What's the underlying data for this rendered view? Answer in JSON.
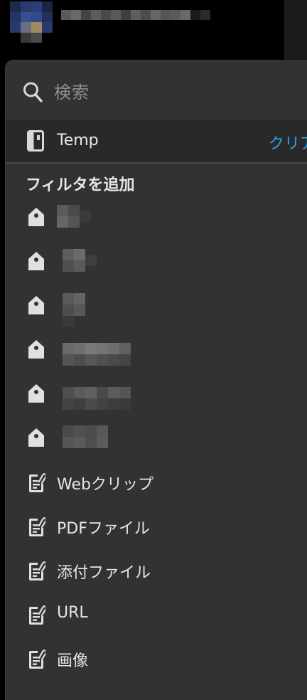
{
  "search": {
    "placeholder": "検索"
  },
  "selected_notebook": {
    "label": "Temp",
    "clear_label": "クリア"
  },
  "filters": {
    "title": "フィルタを追加",
    "tags": [
      {
        "label": ""
      },
      {
        "label": ""
      },
      {
        "label": ""
      },
      {
        "label": ""
      },
      {
        "label": ""
      },
      {
        "label": ""
      }
    ],
    "types": [
      {
        "label": "Webクリップ"
      },
      {
        "label": "PDFファイル"
      },
      {
        "label": "添付ファイル"
      },
      {
        "label": "URL"
      },
      {
        "label": "画像"
      }
    ]
  },
  "colors": {
    "panel": "#323232",
    "selected_row": "#292929",
    "accent": "#2aa3ee",
    "text": "#e6e6e6",
    "placeholder": "#8e8e8e"
  },
  "icons": {
    "search": "search-icon",
    "notebook": "notebook-icon",
    "tag": "tag-icon",
    "attachment": "note-attachment-icon"
  }
}
